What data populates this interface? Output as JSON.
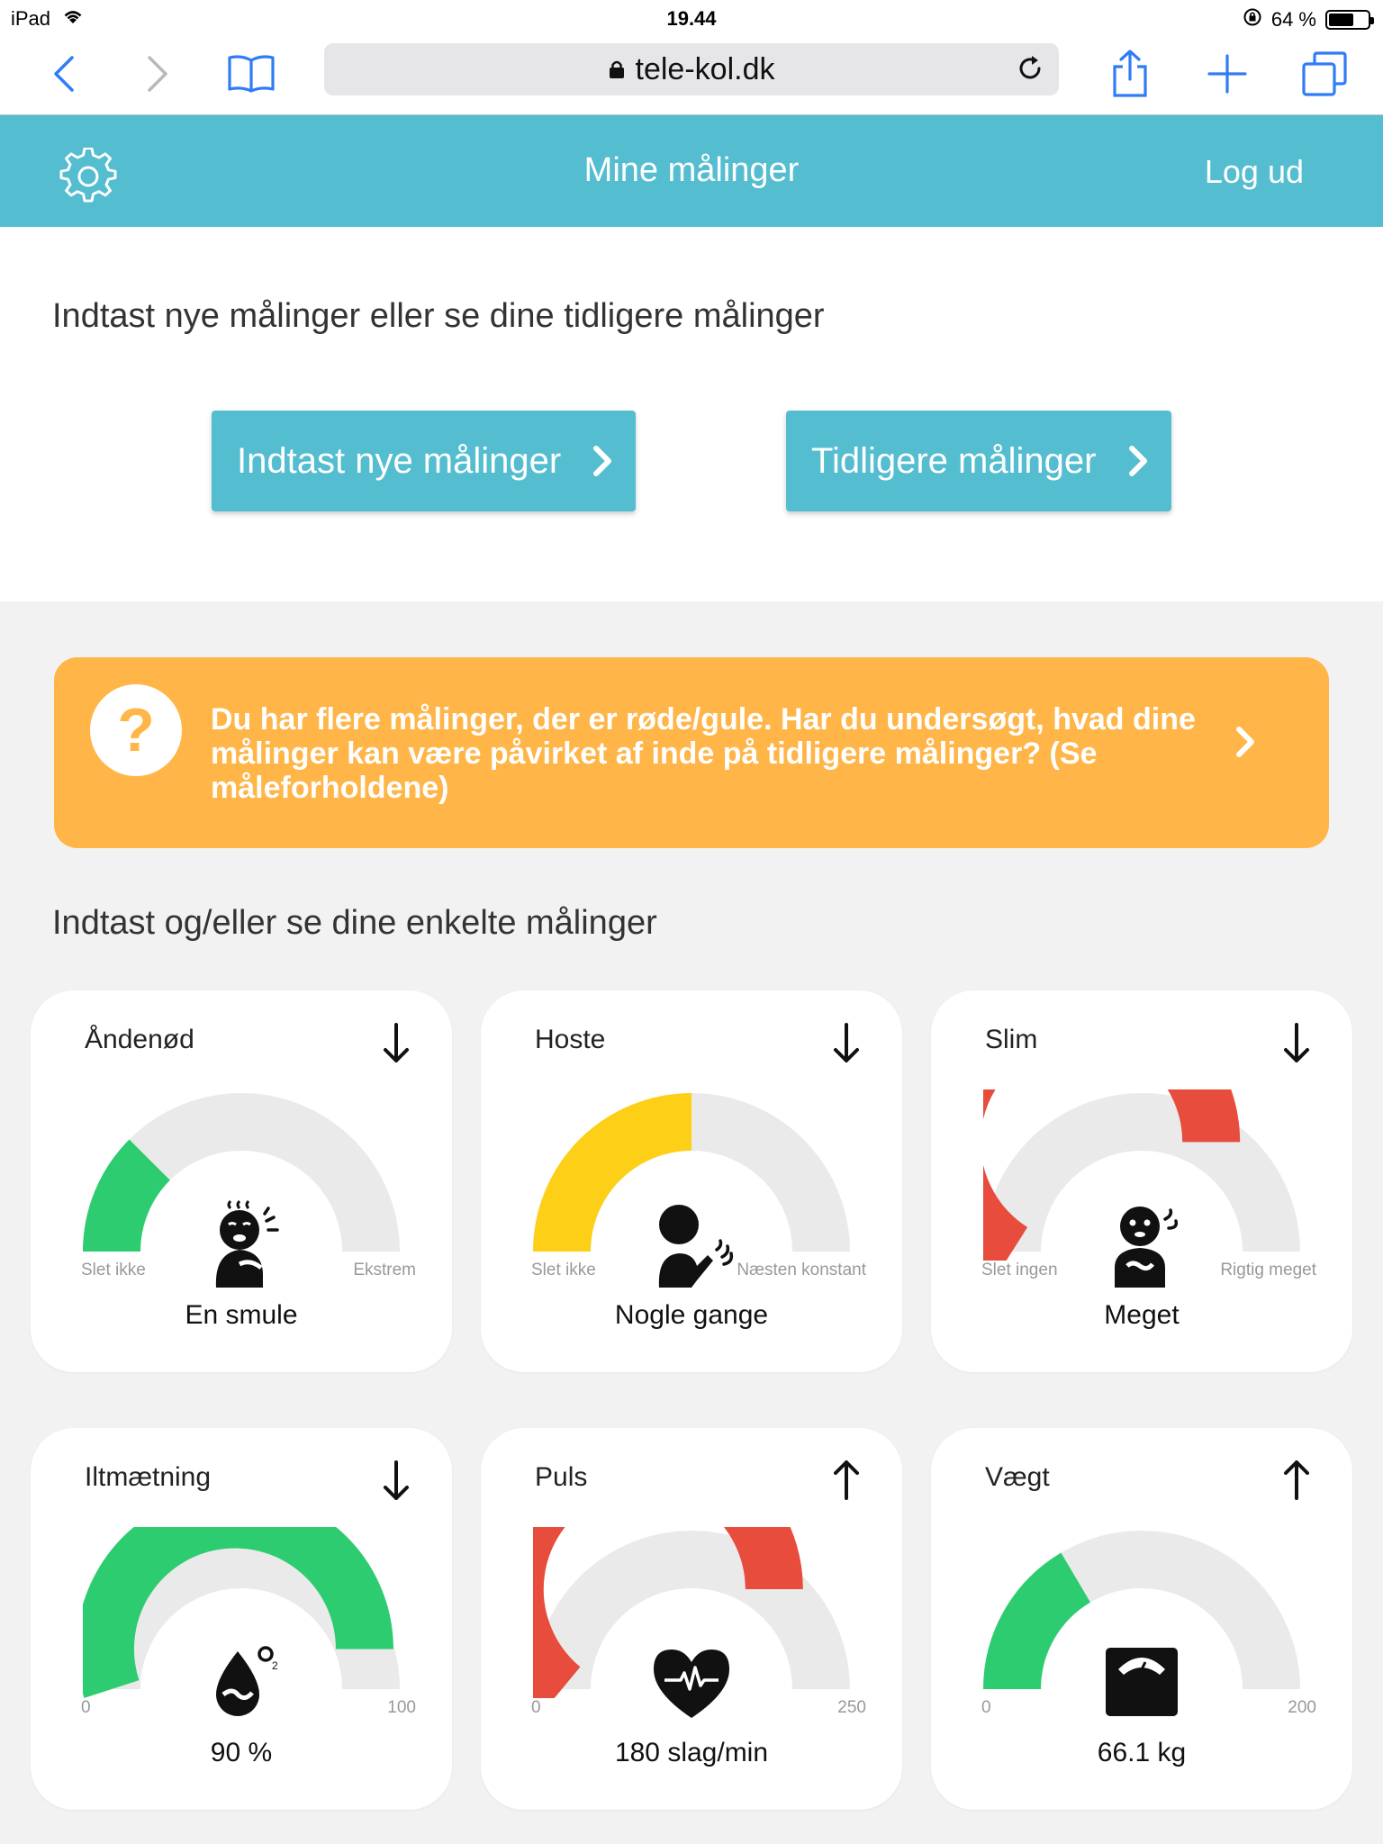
{
  "status_bar": {
    "device": "iPad",
    "time": "19.44",
    "battery": "64 %",
    "battery_level": 0.64
  },
  "browser": {
    "url": "tele-kol.dk"
  },
  "header": {
    "title": "Mine målinger",
    "logout": "Log ud"
  },
  "intro": {
    "heading": "Indtast nye målinger eller se dine tidligere målinger",
    "new_button": "Indtast nye målinger",
    "previous_button": "Tidligere målinger"
  },
  "alert": {
    "text": "Du har flere målinger, der er røde/gule. Har du undersøgt, hvad dine målinger kan være påvirket af inde på tidligere målinger? (Se måleforholdene)"
  },
  "section_title": "Indtast og/eller se dine enkelte målinger",
  "colors": {
    "teal": "#54bdcf",
    "orange": "#ffb547",
    "green": "#2ecc71",
    "yellow": "#fdd017",
    "red": "#e74c3c",
    "track": "#ebeaeb"
  },
  "cards": [
    {
      "name": "Åndenød",
      "trend": "down",
      "min_label": "Slet ikke",
      "max_label": "Ekstrem",
      "value": "En smule",
      "level": 0.25,
      "color": "green",
      "icon": "breathless-person-icon"
    },
    {
      "name": "Hoste",
      "trend": "down",
      "min_label": "Slet ikke",
      "max_label": "Næsten konstant",
      "value": "Nogle gange",
      "level": 0.5,
      "color": "yellow",
      "icon": "coughing-person-icon"
    },
    {
      "name": "Slim",
      "trend": "down",
      "min_label": "Slet ingen",
      "max_label": "Rigtig meget",
      "value": "Meget",
      "level": 0.68,
      "color": "red",
      "icon": "mucus-person-icon"
    },
    {
      "name": "Iltmætning",
      "trend": "down",
      "min_label": "0",
      "max_label": "100",
      "value": "90 %",
      "level": 0.9,
      "color": "green",
      "icon": "oxygen-drop-icon"
    },
    {
      "name": "Puls",
      "trend": "up",
      "min_label": "0",
      "max_label": "250",
      "value": "180 slag/min",
      "level": 0.72,
      "color": "red",
      "icon": "heart-pulse-icon"
    },
    {
      "name": "Vægt",
      "trend": "up",
      "min_label": "0",
      "max_label": "200",
      "value": "66.1 kg",
      "level": 0.33,
      "color": "green",
      "icon": "scale-icon"
    }
  ]
}
